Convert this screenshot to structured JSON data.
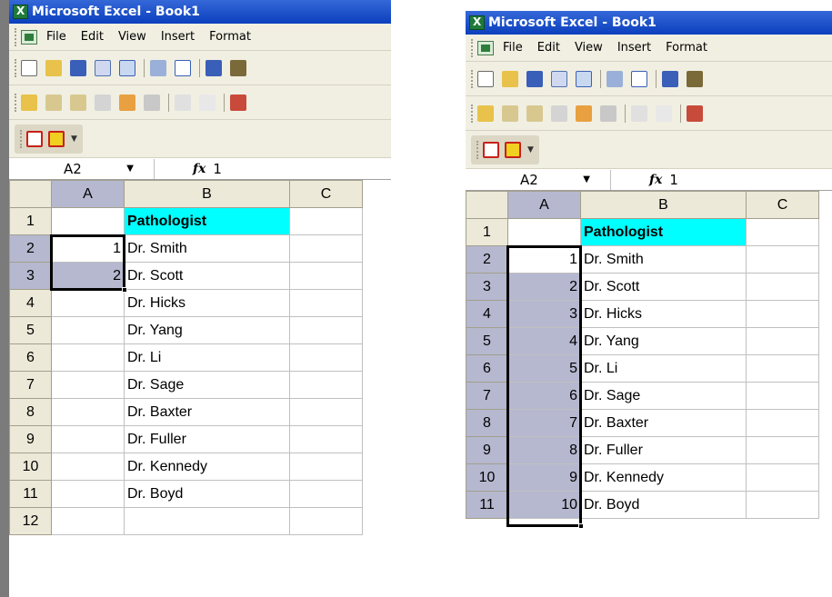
{
  "left": {
    "title": "Microsoft Excel - Book1",
    "menu": [
      "File",
      "Edit",
      "View",
      "Insert",
      "Format"
    ],
    "namebox": "A2",
    "formula": "1",
    "col_headers": [
      "A",
      "B",
      "C"
    ],
    "rows": [
      {
        "n": "1",
        "a": "",
        "b": "Pathologist"
      },
      {
        "n": "2",
        "a": "1",
        "b": "Dr. Smith"
      },
      {
        "n": "3",
        "a": "2",
        "b": "Dr. Scott"
      },
      {
        "n": "4",
        "a": "",
        "b": "Dr. Hicks"
      },
      {
        "n": "5",
        "a": "",
        "b": "Dr. Yang"
      },
      {
        "n": "6",
        "a": "",
        "b": "Dr. Li"
      },
      {
        "n": "7",
        "a": "",
        "b": "Dr. Sage"
      },
      {
        "n": "8",
        "a": "",
        "b": "Dr. Baxter"
      },
      {
        "n": "9",
        "a": "",
        "b": "Dr. Fuller"
      },
      {
        "n": "10",
        "a": "",
        "b": "Dr. Kennedy"
      },
      {
        "n": "11",
        "a": "",
        "b": "Dr. Boyd"
      },
      {
        "n": "12",
        "a": "",
        "b": ""
      }
    ]
  },
  "right": {
    "title": "Microsoft Excel - Book1",
    "menu": [
      "File",
      "Edit",
      "View",
      "Insert",
      "Format"
    ],
    "namebox": "A2",
    "formula": "1",
    "col_headers": [
      "A",
      "B",
      "C"
    ],
    "rows": [
      {
        "n": "1",
        "a": "",
        "b": "Pathologist"
      },
      {
        "n": "2",
        "a": "1",
        "b": "Dr. Smith"
      },
      {
        "n": "3",
        "a": "2",
        "b": "Dr. Scott"
      },
      {
        "n": "4",
        "a": "3",
        "b": "Dr. Hicks"
      },
      {
        "n": "5",
        "a": "4",
        "b": "Dr. Yang"
      },
      {
        "n": "6",
        "a": "5",
        "b": "Dr. Li"
      },
      {
        "n": "7",
        "a": "6",
        "b": "Dr. Sage"
      },
      {
        "n": "8",
        "a": "7",
        "b": "Dr. Baxter"
      },
      {
        "n": "9",
        "a": "8",
        "b": "Dr. Fuller"
      },
      {
        "n": "10",
        "a": "9",
        "b": "Dr. Kennedy"
      },
      {
        "n": "11",
        "a": "10",
        "b": "Dr. Boyd"
      }
    ]
  },
  "colors": {
    "header_fill": "#00ffff",
    "selection_fill": "#b5b8cf",
    "titlebar": "#0b3fbe",
    "chrome": "#f1efe2"
  },
  "icons": {
    "toolbar1": [
      "new-icon",
      "open-icon",
      "save-icon",
      "permission-icon",
      "print-preview-icon",
      "print-icon",
      "preview-icon",
      "spelling-icon",
      "research-icon"
    ],
    "toolbar2": [
      "new-comment-icon",
      "previous-comment-icon",
      "next-comment-icon",
      "show-comment-icon",
      "show-all-comments-icon",
      "delete-comment-icon",
      "shadow-icon",
      "undo-icon",
      "review-icon"
    ],
    "pdf": [
      "pdf-convert-icon",
      "pdf-attach-icon"
    ]
  }
}
